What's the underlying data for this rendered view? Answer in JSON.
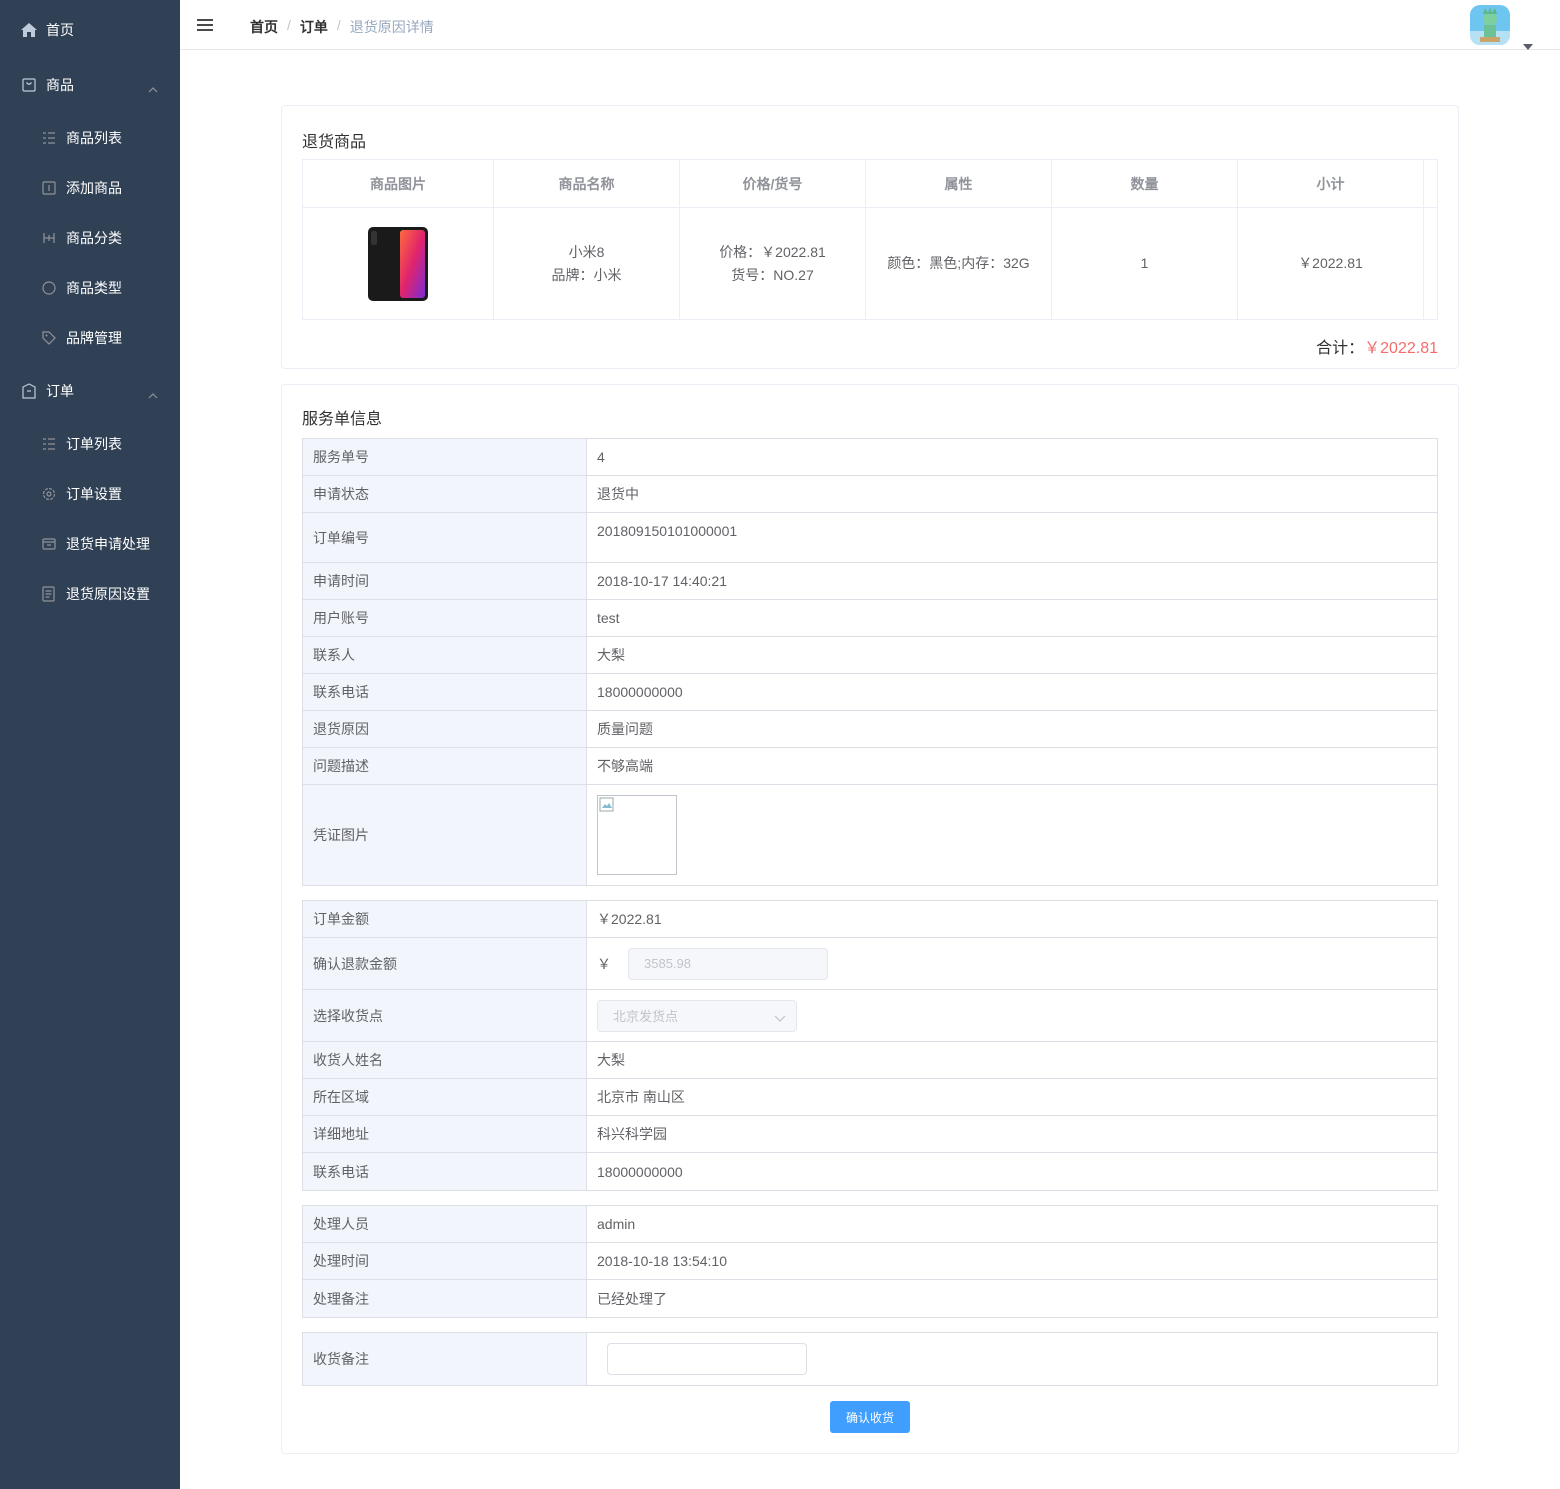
{
  "sidebar": {
    "home": "首页",
    "goods": "商品",
    "goods_items": [
      "商品列表",
      "添加商品",
      "商品分类",
      "商品类型",
      "品牌管理"
    ],
    "order": "订单",
    "order_items": [
      "订单列表",
      "订单设置",
      "退货申请处理",
      "退货原因设置"
    ]
  },
  "header": {
    "breadcrumb": [
      "首页",
      "订单",
      "退货原因详情"
    ]
  },
  "goods_card": {
    "title": "退货商品",
    "columns": [
      "商品图片",
      "商品名称",
      "价格/货号",
      "属性",
      "数量",
      "小计"
    ],
    "row": {
      "name": "小米8",
      "brand": "品牌：小米",
      "price": "价格：￥2022.81",
      "sn": "货号：NO.27",
      "attr": "颜色：黑色;内存：32G",
      "quantity": "1",
      "subtotal": "￥2022.81"
    },
    "total_label": "合计：",
    "total_value": "￥2022.81"
  },
  "service_card": {
    "title": "服务单信息",
    "basic": [
      {
        "label": "服务单号",
        "value": "4"
      },
      {
        "label": "申请状态",
        "value": "退货中"
      },
      {
        "label": "订单编号",
        "value": "201809150101000001"
      },
      {
        "label": "申请时间",
        "value": "2018-10-17 14:40:21"
      },
      {
        "label": "用户账号",
        "value": "test"
      },
      {
        "label": "联系人",
        "value": "大梨"
      },
      {
        "label": "联系电话",
        "value": "18000000000"
      },
      {
        "label": "退货原因",
        "value": "质量问题"
      },
      {
        "label": "问题描述",
        "value": "不够高端"
      },
      {
        "label": "凭证图片",
        "value": ""
      }
    ],
    "refund": {
      "order_amount_label": "订单金额",
      "order_amount": "￥2022.81",
      "confirm_amount_label": "确认退款金额",
      "currency": "￥",
      "confirm_amount_value": "3585.98",
      "address_select_label": "选择收货点",
      "address_select_value": "北京发货点",
      "rows": [
        {
          "label": "收货人姓名",
          "value": "大梨"
        },
        {
          "label": "所在区域",
          "value": "北京市 南山区"
        },
        {
          "label": "详细地址",
          "value": "科兴科学园"
        },
        {
          "label": "联系电话",
          "value": "18000000000"
        }
      ]
    },
    "handle": [
      {
        "label": "处理人员",
        "value": "admin"
      },
      {
        "label": "处理时间",
        "value": "2018-10-18 13:54:10"
      },
      {
        "label": "处理备注",
        "value": "已经处理了"
      }
    ],
    "receive_note_label": "收货备注",
    "receive_note_value": "",
    "confirm_button": "确认收货"
  },
  "colors": {
    "sidebar_bg": "#304156",
    "primary": "#409eff",
    "danger": "#f56c6c"
  }
}
